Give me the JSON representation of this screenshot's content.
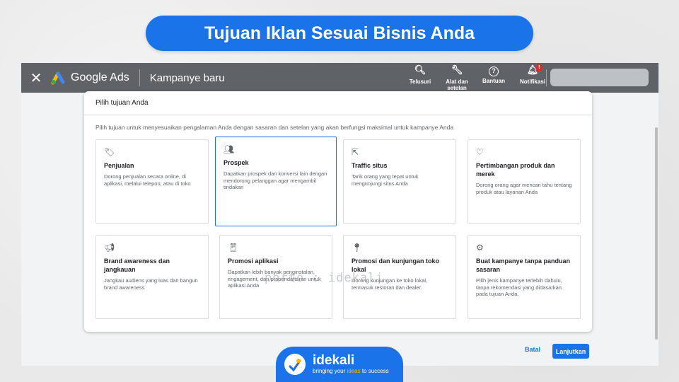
{
  "slide_title": "Tujuan Iklan Sesuai Bisnis Anda",
  "app": {
    "close_icon": "✕",
    "brand": "Google Ads",
    "campaign_title": "Kampanye baru",
    "tools": [
      {
        "icon": "search-icon",
        "glyph": "🔍︎",
        "label": "Telusuri"
      },
      {
        "icon": "wrench-icon",
        "glyph": "🔧︎",
        "label": "Alat dan setelan"
      },
      {
        "icon": "help-icon",
        "glyph": "?",
        "label": "Bantuan"
      },
      {
        "icon": "bell-icon",
        "glyph": "🔔︎",
        "label": "Notifikasi",
        "badge": "!"
      }
    ]
  },
  "dialog": {
    "heading": "Pilih tujuan Anda",
    "description": "Pilih tujuan untuk menyesuaikan pengalaman Anda dengan sasaran dan setelan yang akan berfungsi maksimal untuk kampanye Anda",
    "goals": [
      {
        "icon": "tag-icon",
        "glyph": "🏷︎",
        "title": "Penjualan",
        "desc": "Dorong penjualan secara online, di aplikasi, melalui telepon, atau di toko"
      },
      {
        "icon": "people-icon",
        "glyph": "👥︎",
        "title": "Prospek",
        "desc": "Dapatkan prospek dan konversi lain dengan mendorong pelanggan agar mengambil tindakan",
        "selected": true
      },
      {
        "icon": "cursor-click-icon",
        "glyph": "⇱",
        "title": "Traffic situs",
        "desc": "Tarik orang yang tepat untuk mengunjungi situs Anda"
      },
      {
        "icon": "heart-icon",
        "glyph": "♡",
        "title": "Pertimbangan produk dan merek",
        "desc": "Dorong orang agar mencari tahu tentang produk atau layanan Anda"
      },
      {
        "icon": "megaphone-icon",
        "glyph": "📢︎",
        "title": "Brand awareness dan jangkauan",
        "desc": "Jangkau audiens yang luas dan bangun brand awareness"
      },
      {
        "icon": "phone-icon",
        "glyph": "📱︎",
        "title": "Promosi aplikasi",
        "desc": "Dapatkan lebih banyak penginstalan, engagement, dan prapendaftaran untuk aplikasi Anda"
      },
      {
        "icon": "location-pin-icon",
        "glyph": "📍︎",
        "title": "Promosi dan kunjungan toko lokal",
        "desc": "Dorong kunjungan ke toko lokal, termasuk restoran dan dealer."
      },
      {
        "icon": "gear-icon",
        "glyph": "⚙",
        "title": "Buat kampanye tanpa panduan sasaran",
        "desc": "Pilih jenis kampanye terlebih dahulu, tanpa rekomendasi yang didasarkan pada tujuan Anda."
      }
    ]
  },
  "actions": {
    "cancel": "Batal",
    "next": "Lanjutkan"
  },
  "watermark": "porto : idekali",
  "footer": {
    "name": "idekali",
    "tag_pre": "bringing your ",
    "tag_hl": "ideas",
    "tag_post": " to success"
  },
  "colors": {
    "accent": "#1a73e8",
    "topbar": "#5f6368",
    "badge": "#d93025"
  }
}
